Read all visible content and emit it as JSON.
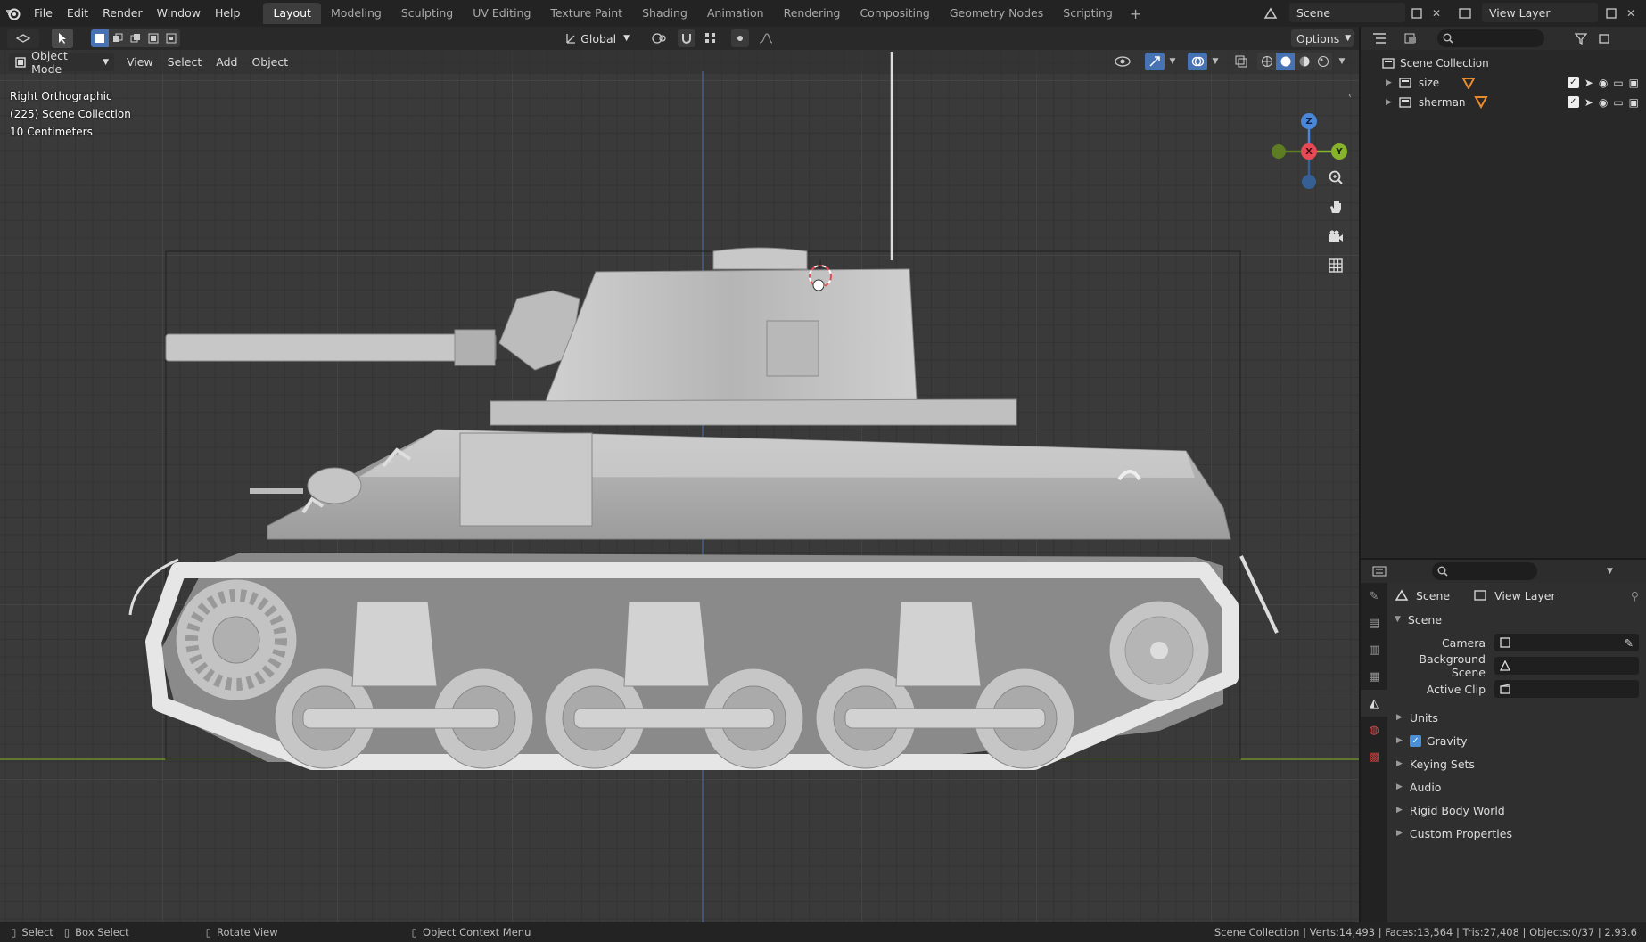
{
  "menu": [
    "File",
    "Edit",
    "Render",
    "Window",
    "Help"
  ],
  "workspaces": [
    {
      "label": "Layout",
      "active": true
    },
    {
      "label": "Modeling"
    },
    {
      "label": "Sculpting"
    },
    {
      "label": "UV Editing"
    },
    {
      "label": "Texture Paint"
    },
    {
      "label": "Shading"
    },
    {
      "label": "Animation"
    },
    {
      "label": "Rendering"
    },
    {
      "label": "Compositing"
    },
    {
      "label": "Geometry Nodes"
    },
    {
      "label": "Scripting"
    }
  ],
  "scene_selector": {
    "value": "Scene"
  },
  "view_layer_selector": {
    "value": "View Layer"
  },
  "viewport": {
    "transform_orientation": "Global",
    "options_label": "Options",
    "mode": "Object Mode",
    "menus": [
      "View",
      "Select",
      "Add",
      "Object"
    ],
    "info_lines": [
      "Right Orthographic",
      "(225) Scene Collection",
      "10 Centimeters"
    ],
    "gizmo_axes": {
      "z": "Z",
      "x": "X",
      "y": "Y"
    },
    "colors": {
      "x_axis": "#e84a55",
      "y_axis": "#86b32a",
      "z_axis": "#4a87d8",
      "ground_line": "#6b8e2a"
    }
  },
  "outliner": {
    "root": "Scene Collection",
    "items": [
      {
        "name": "size",
        "visible": true
      },
      {
        "name": "sherman",
        "visible": true
      }
    ]
  },
  "properties": {
    "breadcrumb": [
      "Scene",
      "View Layer"
    ],
    "section_title": "Scene",
    "fields": [
      {
        "label": "Camera",
        "value": ""
      },
      {
        "label": "Background Scene",
        "value": ""
      },
      {
        "label": "Active Clip",
        "value": ""
      }
    ],
    "subsections": [
      {
        "label": "Units"
      },
      {
        "label": "Gravity",
        "checkbox": true,
        "checked": true
      },
      {
        "label": "Keying Sets"
      },
      {
        "label": "Audio"
      },
      {
        "label": "Rigid Body World"
      },
      {
        "label": "Custom Properties"
      }
    ]
  },
  "statusbar": {
    "hints": [
      "Select",
      "Box Select",
      "Rotate View",
      "Object Context Menu"
    ],
    "stats": "Scene Collection | Verts:14,493 | Faces:13,564 | Tris:27,408 | Objects:0/37 | 2.93.6"
  }
}
